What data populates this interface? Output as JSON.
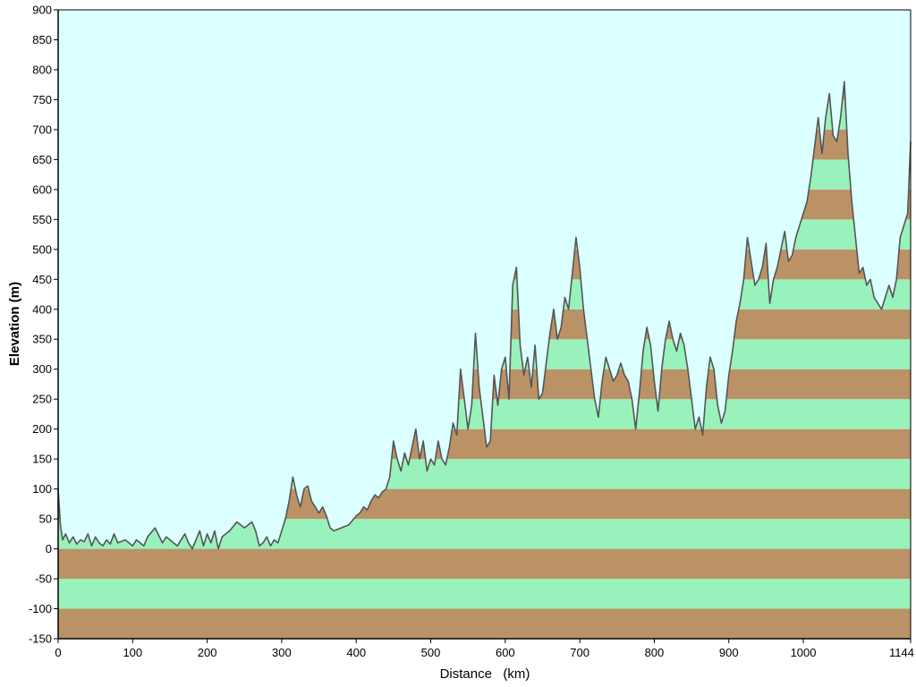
{
  "chart_data": {
    "type": "area",
    "title": "",
    "xlabel": "Distance   (km)",
    "ylabel": "Elevation (m)",
    "xlim": [
      0,
      1144
    ],
    "ylim": [
      -150,
      900
    ],
    "x_ticks": [
      0,
      100,
      200,
      300,
      400,
      500,
      600,
      700,
      800,
      900,
      1000,
      1144
    ],
    "y_ticks": [
      900,
      850,
      800,
      750,
      700,
      650,
      600,
      550,
      500,
      450,
      400,
      350,
      300,
      250,
      200,
      150,
      100,
      50,
      0,
      -50,
      -100,
      -150
    ],
    "band_step": 50,
    "grid": false,
    "colors": {
      "sky": "#dcffff",
      "band_light": "#99f2bb",
      "band_dark": "#bb9266",
      "profile_line": "#555555",
      "axis": "#000000"
    },
    "series": [
      {
        "x": [
          0,
          3,
          6,
          10,
          15,
          20,
          25,
          30,
          35,
          40,
          45,
          50,
          55,
          60,
          65,
          70,
          75,
          80,
          90,
          100,
          105,
          110,
          115,
          120,
          130,
          140,
          145,
          150,
          160,
          165,
          170,
          175,
          180,
          185,
          190,
          195,
          200,
          205,
          210,
          215,
          220,
          230,
          240,
          250,
          260,
          265,
          270,
          275,
          280,
          285,
          290,
          295,
          300,
          305,
          310,
          315,
          320,
          325,
          330,
          335,
          340,
          345,
          350,
          355,
          360,
          365,
          370,
          380,
          390,
          400,
          405,
          410,
          415,
          420,
          425,
          430,
          435,
          440,
          445,
          450,
          455,
          460,
          465,
          470,
          475,
          480,
          485,
          490,
          495,
          500,
          505,
          510,
          515,
          520,
          525,
          530,
          535,
          540,
          545,
          550,
          555,
          560,
          565,
          570,
          575,
          580,
          585,
          590,
          595,
          600,
          605,
          610,
          615,
          620,
          625,
          630,
          635,
          640,
          645,
          650,
          655,
          660,
          665,
          670,
          675,
          680,
          685,
          690,
          695,
          700,
          705,
          710,
          715,
          720,
          725,
          730,
          735,
          740,
          745,
          750,
          755,
          760,
          765,
          770,
          775,
          780,
          785,
          790,
          795,
          800,
          805,
          810,
          815,
          820,
          825,
          830,
          835,
          840,
          845,
          850,
          855,
          860,
          865,
          870,
          875,
          880,
          885,
          890,
          895,
          900,
          905,
          910,
          915,
          920,
          925,
          930,
          935,
          940,
          945,
          950,
          955,
          960,
          965,
          970,
          975,
          980,
          985,
          990,
          995,
          1000,
          1005,
          1010,
          1015,
          1020,
          1025,
          1030,
          1035,
          1040,
          1045,
          1050,
          1055,
          1060,
          1065,
          1070,
          1075,
          1080,
          1085,
          1090,
          1095,
          1100,
          1105,
          1110,
          1115,
          1120,
          1125,
          1130,
          1135,
          1140,
          1144
        ],
        "values": [
          100,
          40,
          15,
          25,
          10,
          20,
          8,
          15,
          12,
          25,
          5,
          20,
          10,
          5,
          15,
          8,
          25,
          10,
          15,
          5,
          15,
          10,
          5,
          20,
          35,
          10,
          20,
          15,
          5,
          15,
          25,
          10,
          0,
          15,
          30,
          5,
          25,
          10,
          30,
          0,
          20,
          30,
          45,
          35,
          45,
          30,
          5,
          10,
          20,
          5,
          15,
          10,
          30,
          50,
          80,
          120,
          90,
          70,
          100,
          105,
          80,
          70,
          60,
          70,
          55,
          35,
          30,
          35,
          40,
          55,
          60,
          70,
          65,
          80,
          90,
          85,
          95,
          100,
          120,
          180,
          150,
          130,
          160,
          140,
          170,
          200,
          150,
          180,
          130,
          150,
          140,
          180,
          150,
          140,
          170,
          210,
          190,
          300,
          250,
          200,
          240,
          360,
          270,
          220,
          170,
          180,
          290,
          240,
          300,
          320,
          250,
          440,
          470,
          340,
          290,
          320,
          270,
          340,
          250,
          260,
          310,
          360,
          400,
          350,
          370,
          420,
          400,
          460,
          520,
          470,
          400,
          350,
          300,
          250,
          220,
          280,
          320,
          300,
          280,
          290,
          310,
          290,
          280,
          250,
          200,
          260,
          330,
          370,
          340,
          280,
          230,
          300,
          350,
          380,
          350,
          330,
          360,
          340,
          300,
          250,
          200,
          220,
          190,
          270,
          320,
          300,
          240,
          210,
          230,
          290,
          330,
          380,
          410,
          450,
          520,
          480,
          440,
          450,
          470,
          510,
          410,
          450,
          470,
          500,
          530,
          480,
          490,
          520,
          540,
          560,
          580,
          620,
          670,
          720,
          660,
          720,
          760,
          690,
          680,
          720,
          780,
          660,
          580,
          520,
          460,
          470,
          440,
          450,
          420,
          410,
          400,
          420,
          440,
          420,
          450,
          520,
          540,
          560,
          680
        ]
      }
    ]
  }
}
